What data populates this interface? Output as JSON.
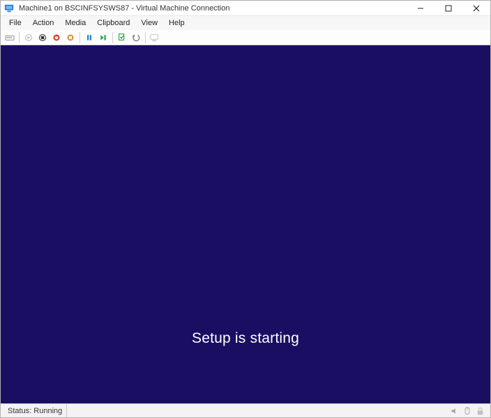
{
  "titlebar": {
    "title": "Machine1 on BSCINFSYSWS87 - Virtual Machine Connection"
  },
  "menubar": {
    "items": [
      {
        "label": "File"
      },
      {
        "label": "Action"
      },
      {
        "label": "Media"
      },
      {
        "label": "Clipboard"
      },
      {
        "label": "View"
      },
      {
        "label": "Help"
      }
    ]
  },
  "toolbar": {
    "buttons": [
      {
        "name": "ctrl-alt-del",
        "enabled": true
      },
      {
        "name": "start",
        "enabled": false
      },
      {
        "name": "turn-off",
        "enabled": true
      },
      {
        "name": "shut-down",
        "enabled": true
      },
      {
        "name": "save",
        "enabled": true
      },
      {
        "name": "pause",
        "enabled": true
      },
      {
        "name": "reset",
        "enabled": true
      },
      {
        "name": "checkpoint",
        "enabled": true
      },
      {
        "name": "revert",
        "enabled": true
      },
      {
        "name": "enhanced-session",
        "enabled": false
      }
    ]
  },
  "vm": {
    "message": "Setup is starting"
  },
  "statusbar": {
    "status": "Status: Running"
  }
}
